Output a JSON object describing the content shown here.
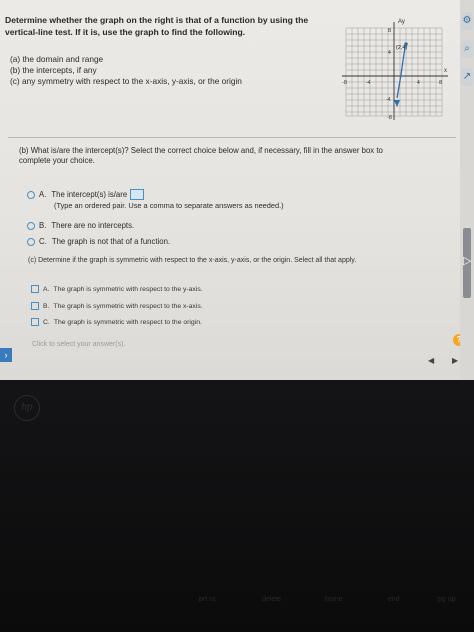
{
  "question": {
    "heading_line1": "Determine whether the graph on the right is that of a function by using the",
    "heading_line2": "vertical-line test. If it is, use the graph to find the following.",
    "parts": [
      "(a) the domain and range",
      "(b) the intercepts, if any",
      "(c) any symmetry with respect to the x-axis, y-axis, or the origin"
    ]
  },
  "graph": {
    "y_label": "Ay",
    "x_label": "x",
    "y_top_tick": "8",
    "y_bottom_tick": "-8",
    "x_left_tick": "-8",
    "x_right_tick": "8",
    "point_label": "(2,4)",
    "tick_4_pos": "4",
    "tick_4_neg": "-4"
  },
  "part_b": {
    "prompt_line1": "(b) What is/are the intercept(s)? Select the correct choice below and, if necessary, fill in the answer box to",
    "prompt_line2": "complete your choice.",
    "choice_a": "A.",
    "choice_a_text": "The intercept(s) is/are",
    "choice_a_hint": "(Type an ordered pair. Use a comma to separate answers as needed.)",
    "choice_b": "B.",
    "choice_b_text": "There are no intercepts.",
    "choice_c": "C.",
    "choice_c_text": "The graph is not that of a function."
  },
  "part_c": {
    "prompt": "(c) Determine if the graph is symmetric with respect to the x-axis, y-axis, or the origin. Select all that apply.",
    "options": [
      {
        "letter": "A.",
        "text": "The graph is symmetric with respect to the y-axis."
      },
      {
        "letter": "B.",
        "text": "The graph is symmetric with respect to the x-axis."
      },
      {
        "letter": "C.",
        "text": "The graph is symmetric with respect to the origin."
      }
    ]
  },
  "footer": {
    "click_note": "Click to select your answer(s).",
    "help_label": "?"
  },
  "keyboard": {
    "hp": "hp",
    "keys": [
      "prt sc",
      "delete",
      "home",
      "end",
      "pg up"
    ]
  },
  "colors": {
    "accent": "#4b8fc0",
    "curve": "#2f6fb0",
    "help": "#f5a623"
  }
}
